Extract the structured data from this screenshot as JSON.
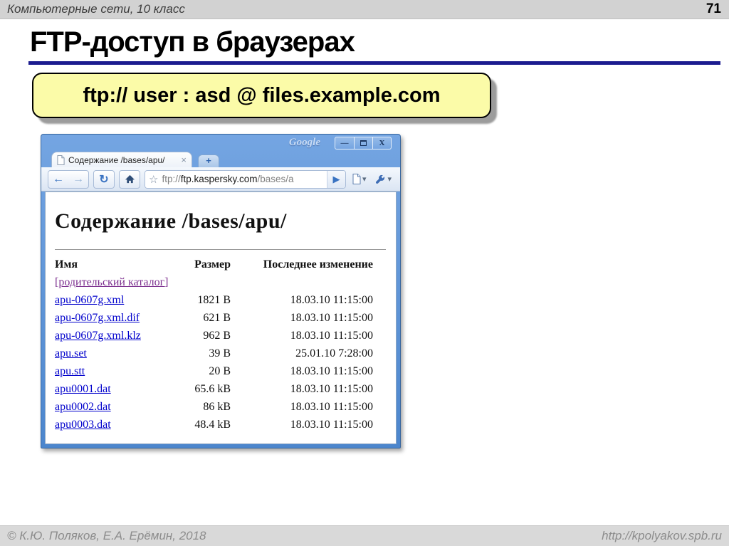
{
  "slide": {
    "header": {
      "course_label": "Компьютерные сети, 10 класс",
      "page_number": "71"
    },
    "title": "FTP-доступ в браузерах",
    "callout_text": "ftp:// user : asd @ files.example.com",
    "footer": {
      "copyright": "© К.Ю. Поляков, Е.А. Ерёмин, 2018",
      "site_url": "http://kpolyakov.spb.ru"
    }
  },
  "browser": {
    "brand": "Google",
    "window_controls": {
      "minimize_glyph": "—",
      "close_glyph": "X"
    },
    "tab": {
      "title": "Содержание /bases/apu/",
      "close_glyph": "×",
      "new_tab_glyph": "+"
    },
    "toolbar": {
      "back_glyph": "←",
      "forward_glyph": "→",
      "reload_glyph": "↻",
      "star_glyph": "☆",
      "url_scheme": "ftp://",
      "url_host": "ftp.kaspersky.com",
      "url_path": "/bases/a",
      "go_glyph": "▶",
      "caret_glyph": "▾"
    },
    "page": {
      "heading": "Содержание /bases/apu/",
      "table": {
        "headers": [
          "Имя",
          "Размер",
          "Последнее изменение"
        ],
        "rows": [
          {
            "name": "[родительский каталог]",
            "size": "",
            "modified": "",
            "visited": true
          },
          {
            "name": "apu-0607g.xml",
            "size": "1821 B",
            "modified": "18.03.10 11:15:00"
          },
          {
            "name": "apu-0607g.xml.dif",
            "size": "621 B",
            "modified": "18.03.10 11:15:00"
          },
          {
            "name": "apu-0607g.xml.klz",
            "size": "962 B",
            "modified": "18.03.10 11:15:00"
          },
          {
            "name": "apu.set",
            "size": "39 B",
            "modified": "25.01.10 7:28:00"
          },
          {
            "name": "apu.stt",
            "size": "20 B",
            "modified": "18.03.10 11:15:00"
          },
          {
            "name": "apu0001.dat",
            "size": "65.6 kB",
            "modified": "18.03.10 11:15:00"
          },
          {
            "name": "apu0002.dat",
            "size": "86 kB",
            "modified": "18.03.10 11:15:00"
          },
          {
            "name": "apu0003.dat",
            "size": "48.4 kB",
            "modified": "18.03.10 11:15:00"
          }
        ]
      }
    }
  },
  "colors": {
    "title_underline": "#1c1c8f",
    "callout_bg": "#fbfba8",
    "callout_shadow": "#9c9c9c",
    "browser_frame_blue": "#4e86cd",
    "link_blue": "#0000cc",
    "visited_link_purple": "#7b2e8e",
    "bar_gray": "#d2d2d2"
  }
}
